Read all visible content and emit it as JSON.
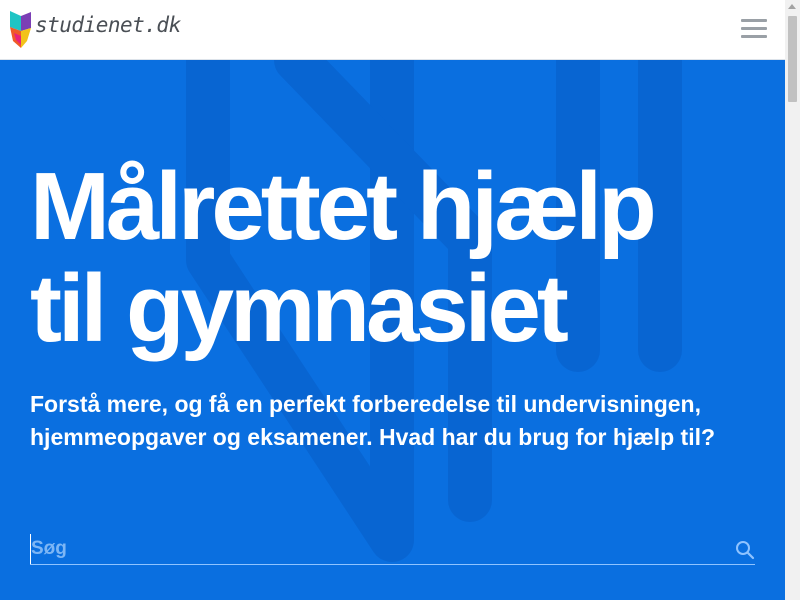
{
  "header": {
    "logo_text": "studienet.dk",
    "logo_icon": "studienet-logo-icon",
    "menu_icon": "hamburger-menu-icon"
  },
  "hero": {
    "headline_line1": "Målrettet hjælp",
    "headline_line2": "til gymnasiet",
    "subtext": "Forstå mere, og få en perfekt forberedelse til undervisningen, hjemmeopgaver og eksamener. Hvad har du brug for hjælp til?",
    "search": {
      "placeholder": "Søg",
      "value": "",
      "icon": "search-icon"
    }
  },
  "colors": {
    "hero_background": "#0a6fe0",
    "header_background": "#ffffff",
    "text_on_hero": "#ffffff"
  }
}
